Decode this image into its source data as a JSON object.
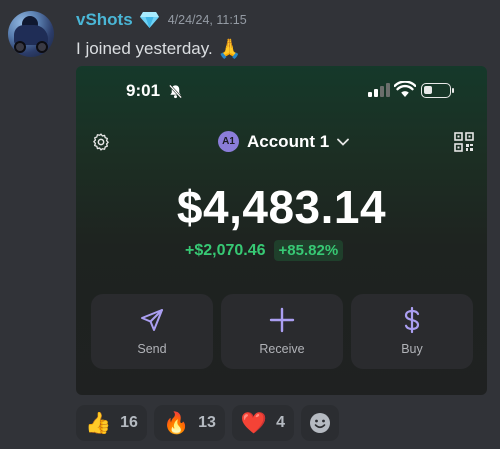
{
  "message": {
    "username": "vShots",
    "badge_icon": "gem-icon",
    "timestamp": "4/24/24, 11:15",
    "text": "I joined yesterday.",
    "emoji": "🙏"
  },
  "phone": {
    "status": {
      "time": "9:01",
      "battery_level": 0.3
    },
    "account_initials": "A1",
    "account_name": "Account 1",
    "balance": "$4,483.14",
    "change_value": "+$2,070.46",
    "change_percent": "+85.82%",
    "actions": [
      {
        "label": "Send",
        "icon": "send-icon"
      },
      {
        "label": "Receive",
        "icon": "plus-icon"
      },
      {
        "label": "Buy",
        "icon": "dollar-icon"
      }
    ],
    "accent_color": "#ab9ff2",
    "positive_color": "#37c974"
  },
  "reactions": [
    {
      "emoji": "👍",
      "count": "16"
    },
    {
      "emoji": "🔥",
      "count": "13"
    },
    {
      "emoji": "❤️",
      "count": "4"
    }
  ]
}
